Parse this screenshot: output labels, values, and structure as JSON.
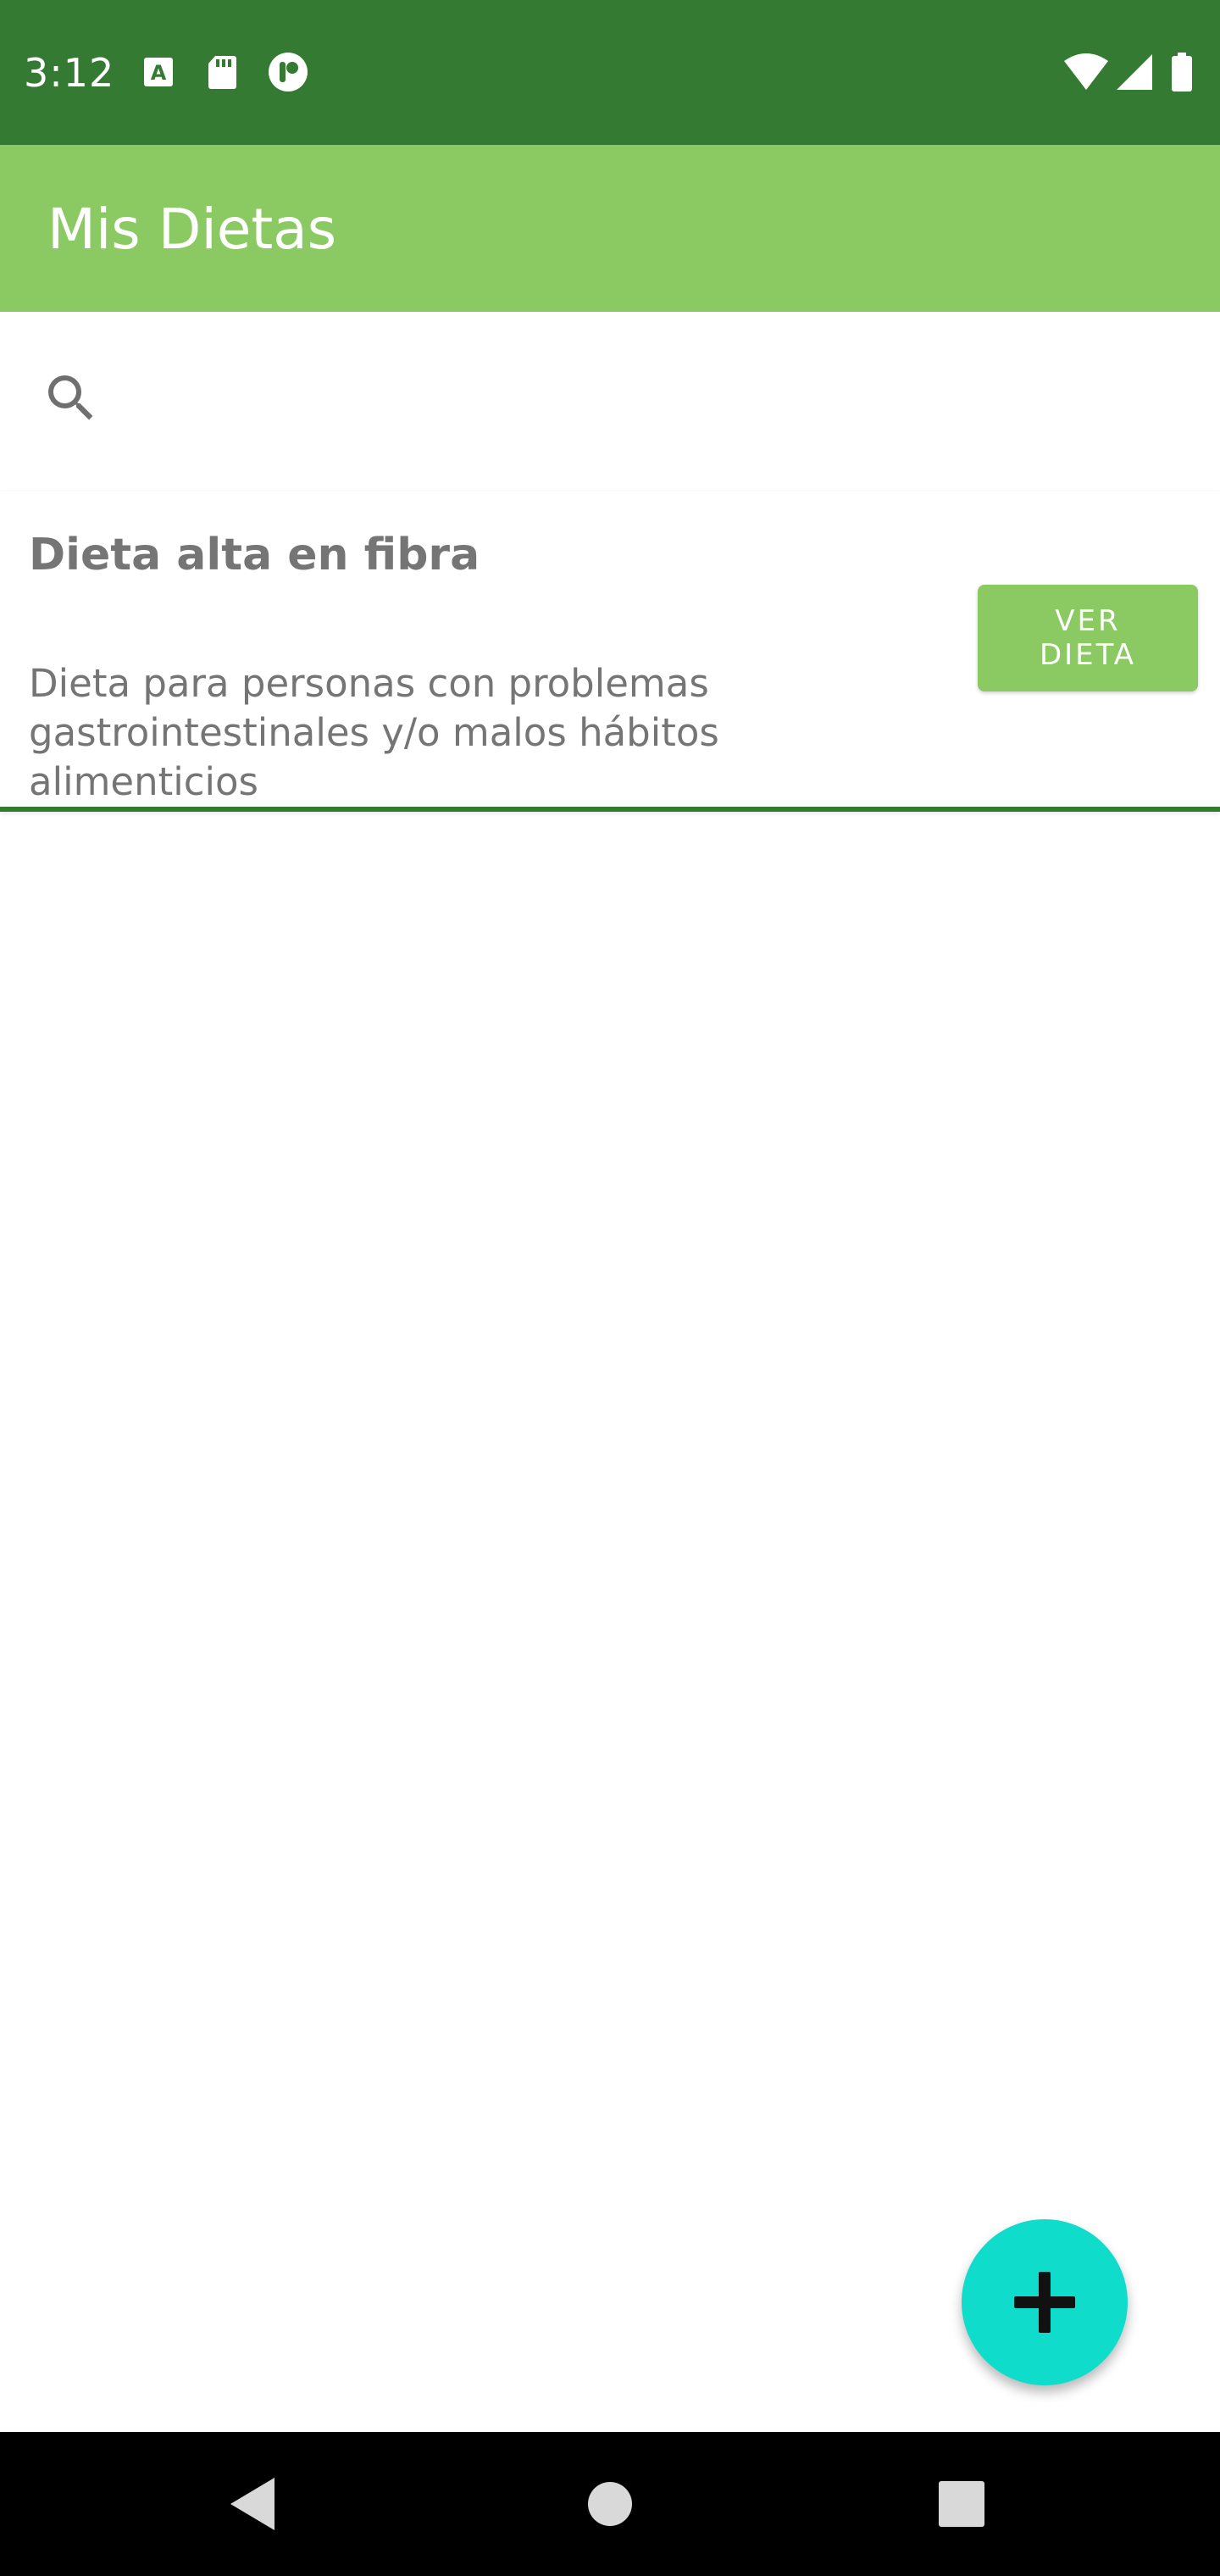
{
  "status_bar": {
    "time": "3:12",
    "icons": [
      "a-notification-icon",
      "sd-card-icon",
      "tasks-icon",
      "wifi-icon",
      "signal-icon",
      "battery-icon"
    ],
    "color": "#357a32"
  },
  "app_bar": {
    "title": "Mis Dietas",
    "color": "#8bc962"
  },
  "search": {
    "icon": "search-icon",
    "placeholder": "",
    "value": ""
  },
  "diets": [
    {
      "title": "Dieta alta en fibra",
      "description": "Dieta para personas con problemas gastrointestinales y/o malos hábitos alimenticios",
      "button_label": "VER\nDIETA"
    }
  ],
  "fab": {
    "icon": "plus-icon",
    "color": "#0fdccb"
  },
  "nav_bar": {
    "icons": [
      "back-icon",
      "home-icon",
      "recents-icon"
    ]
  }
}
